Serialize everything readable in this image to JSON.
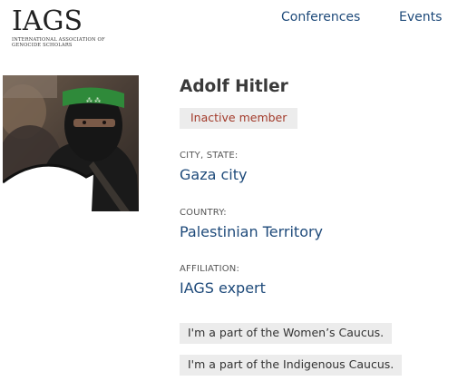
{
  "logo": {
    "letters": "IAGS",
    "line1": "INTERNATIONAL ASSOCIATION OF",
    "line2": "GENOCIDE SCHOLARS"
  },
  "nav": {
    "conferences": "Conferences",
    "events": "Events"
  },
  "profile": {
    "name": "Adolf Hitler",
    "status": "Inactive member",
    "fields": [
      {
        "label": "CITY, STATE:",
        "value": "Gaza city"
      },
      {
        "label": "COUNTRY:",
        "value": "Palestinian Territory"
      },
      {
        "label": "AFFILIATION:",
        "value": "IAGS expert"
      }
    ],
    "caucuses": [
      "I'm a part of the Women’s Caucus.",
      "I'm a part of the Indigenous Caucus."
    ]
  },
  "colors": {
    "link": "#1e4a7a",
    "status": "#a23a2a",
    "chip_bg": "#ececec",
    "headband": "#2f8a3a"
  }
}
